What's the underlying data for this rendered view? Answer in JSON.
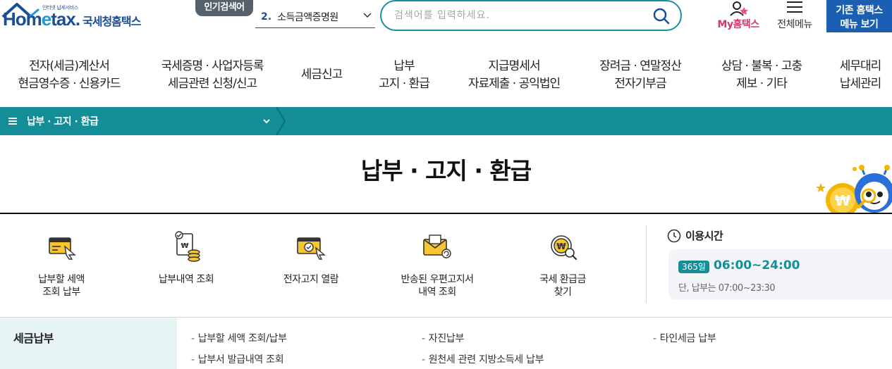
{
  "header": {
    "logo_small": "인터넷 납세서비스",
    "logo_text_home": "Hom",
    "logo_text_e": "e",
    "logo_text_tax": "tax.",
    "logo_korean": "국세청홈택스",
    "popular_badge": "인기검색어",
    "popular_rank": "2.",
    "popular_term": "소득금액증명원",
    "search_placeholder": "검색어를 입력하세요.",
    "my_hometax": "My홈택스",
    "all_menu": "전체메뉴",
    "legacy_line1": "기존 홈택스",
    "legacy_line2": "메뉴 보기"
  },
  "nav": [
    {
      "line1": "전자(세금)계산서",
      "line2": "현금영수증 · 신용카드"
    },
    {
      "line1": "국세증명 · 사업자등록",
      "line2": "세금관련 신청/신고"
    },
    {
      "line1": "세금신고",
      "line2": ""
    },
    {
      "line1": "납부",
      "line2": "고지 · 환급"
    },
    {
      "line1": "지급명세서",
      "line2": "자료제출 · 공익법인"
    },
    {
      "line1": "장려금 · 연말정산",
      "line2": "전자기부금"
    },
    {
      "line1": "상담 · 불복 · 고충",
      "line2": "제보 · 기타"
    },
    {
      "line1": "세무대리",
      "line2": "납세관리"
    }
  ],
  "location": {
    "current": "납부 · 고지 · 환급"
  },
  "page_title": "납부 · 고지 · 환급",
  "quick_links": [
    {
      "line1": "납부할 세액",
      "line2": "조회 납부",
      "icon": "invoice-pay-icon"
    },
    {
      "line1": "납부내역 조회",
      "line2": "",
      "icon": "payment-history-icon"
    },
    {
      "line1": "전자고지 열람",
      "line2": "",
      "icon": "e-notice-icon"
    },
    {
      "line1": "반송된 우편고지서",
      "line2": "내역 조회",
      "icon": "returned-mail-icon"
    },
    {
      "line1": "국세 환급금",
      "line2": "찾기",
      "icon": "refund-search-icon"
    }
  ],
  "hours": {
    "title": "이용시간",
    "days": "365일",
    "time": "06:00~24:00",
    "note": "단, 납부는 07:00~23:30"
  },
  "section": {
    "category": "세금납부",
    "links": [
      "납부할 세액 조회/납부",
      "자진납부",
      "타인세금 납부",
      "납부서 발급내역 조회",
      "원천세 관련 지방소득세 납부"
    ],
    "dash": "-"
  },
  "colors": {
    "teal": "#138e98",
    "navy": "#1b4e97",
    "blue_button": "#1b5fb3",
    "pink": "#d23870",
    "yellow": "#f5c518"
  }
}
